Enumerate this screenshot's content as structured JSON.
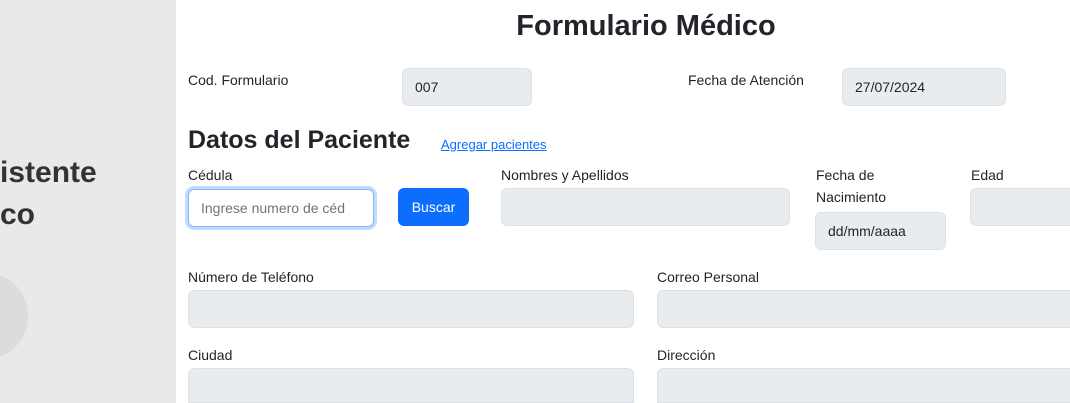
{
  "sidebar": {
    "brand_line1": "istente",
    "brand_line2": "co"
  },
  "form": {
    "title": "Formulario Médico",
    "cod_label": "Cod. Formulario",
    "cod_value": "007",
    "fecha_label": "Fecha de Atención",
    "fecha_value": "27/07/2024"
  },
  "paciente": {
    "section_title": "Datos del Paciente",
    "add_link": "Agregar pacientes",
    "cedula_label": "Cédula",
    "cedula_placeholder": "Ingrese numero de céd",
    "buscar_label": "Buscar",
    "nombres_label": "Nombres y Apellidos",
    "nombres_value": "",
    "fecha_nac_label": "Fecha de Nacimiento",
    "fecha_nac_value": "dd/mm/aaaa",
    "edad_label": "Edad",
    "edad_value": "",
    "telefono_label": "Número de Teléfono",
    "telefono_value": "",
    "correo_label": "Correo Personal",
    "correo_value": "",
    "ciudad_label": "Ciudad",
    "ciudad_value": "",
    "direccion_label": "Dirección",
    "direccion_value": ""
  }
}
